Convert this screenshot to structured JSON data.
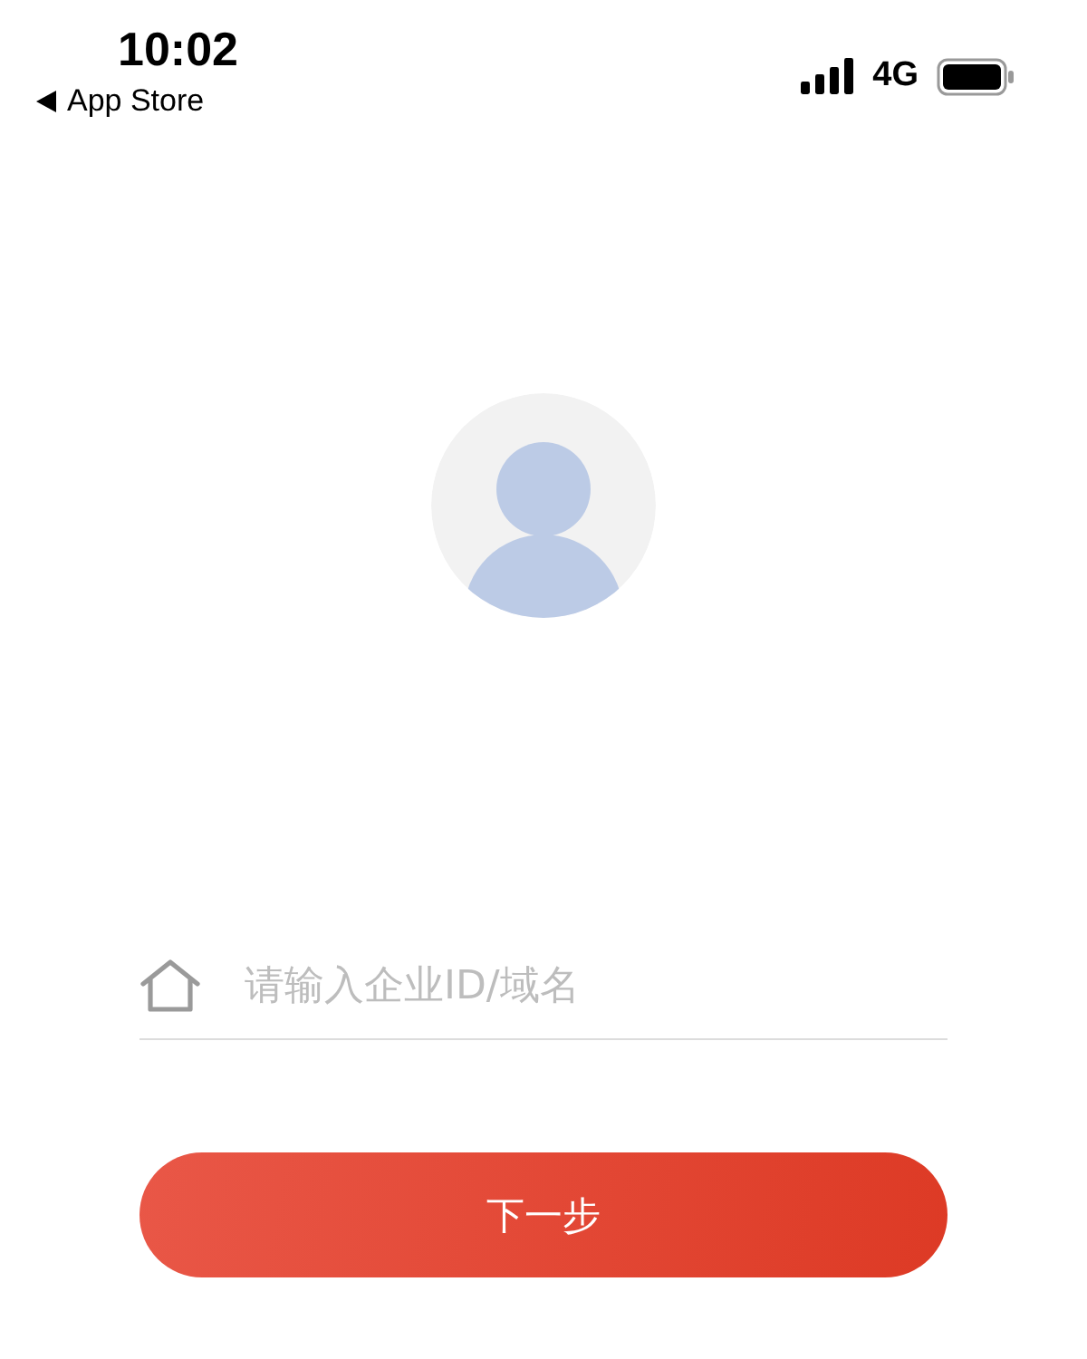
{
  "status_bar": {
    "time": "10:02",
    "back_label": "App Store",
    "network": "4G"
  },
  "login": {
    "avatar": {
      "kind": "default"
    },
    "company_field": {
      "placeholder": "请输入企业ID/域名"
    },
    "next_button": {
      "label": "下一步"
    }
  }
}
